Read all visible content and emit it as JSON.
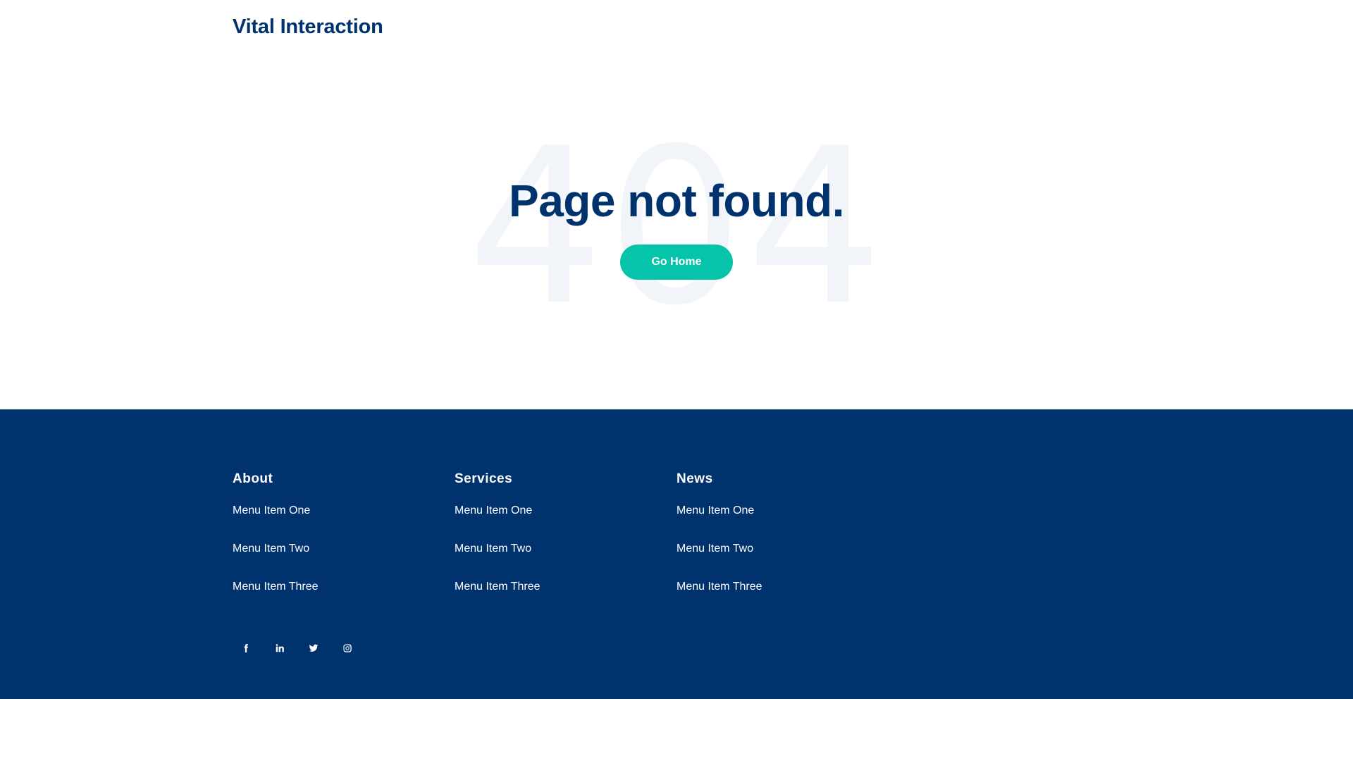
{
  "header": {
    "logo": "Vital Interaction"
  },
  "hero": {
    "background_text": "404",
    "title": "Page not found.",
    "button_label": "Go Home"
  },
  "footer": {
    "columns": [
      {
        "title": "About",
        "items": [
          "Menu Item One",
          "Menu Item Two",
          "Menu Item Three"
        ]
      },
      {
        "title": "Services",
        "items": [
          "Menu Item One",
          "Menu Item Two",
          "Menu Item Three"
        ]
      },
      {
        "title": "News",
        "items": [
          "Menu Item One",
          "Menu Item Two",
          "Menu Item Three"
        ]
      }
    ],
    "social_icons": [
      "facebook-icon",
      "linkedin-icon",
      "twitter-icon",
      "instagram-icon"
    ]
  },
  "colors": {
    "brand": "#00326e",
    "accent": "#05c4a9",
    "background_number": "#f1f4f8"
  }
}
